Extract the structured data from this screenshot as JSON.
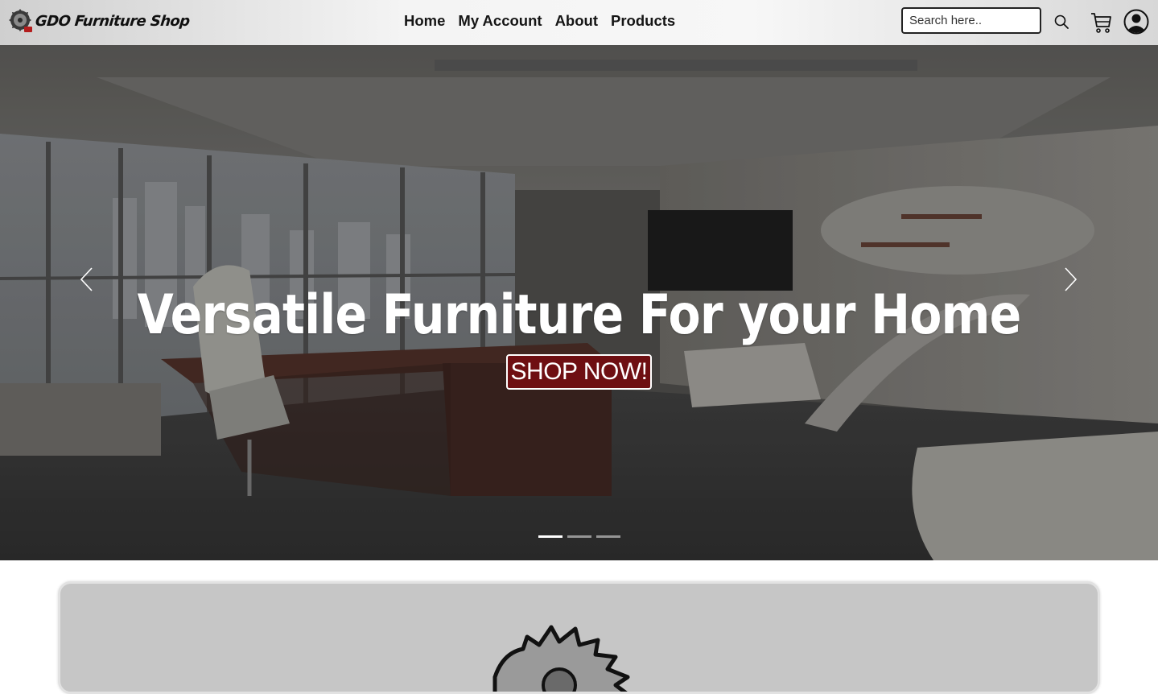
{
  "header": {
    "brand_name": "GDO Furniture Shop",
    "nav": [
      "Home",
      "My Account",
      "About",
      "Products"
    ],
    "search_placeholder": "Search here.."
  },
  "hero": {
    "title": "Versatile Furniture For your Home",
    "cta_label": "SHOP NOW!",
    "slides_total": 3,
    "active_slide": 1
  },
  "icons": {
    "brand_logo": "saw-blade-icon",
    "search": "search-icon",
    "cart": "cart-icon",
    "account": "user-circle-icon",
    "prev": "chevron-left-icon",
    "next": "chevron-right-icon",
    "promo": "saw-blade-icon"
  },
  "colors": {
    "cta_background": "#6e0f12",
    "navbar_background": "#f4f4f4",
    "promo_card_background": "#c6c6c6"
  }
}
